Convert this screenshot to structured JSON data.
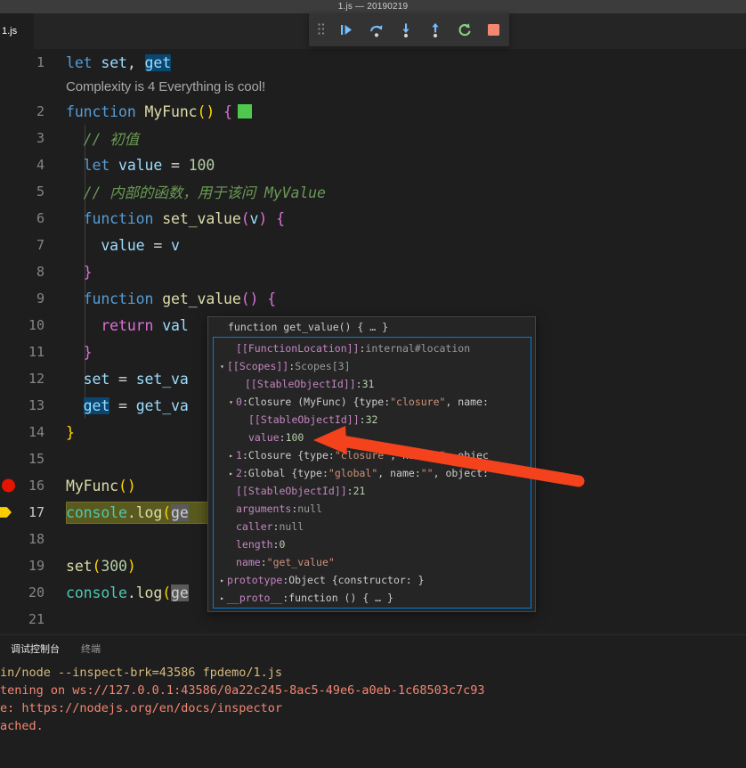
{
  "window": {
    "title": "1.js — 20190219"
  },
  "tabs": {
    "active_label": "1.js"
  },
  "debug_toolbar": {
    "grip": "drag-handle",
    "buttons": [
      {
        "name": "continue-button",
        "label": "Continue",
        "icon": "continue-icon"
      },
      {
        "name": "step-over-button",
        "label": "Step Over",
        "icon": "step-over-icon"
      },
      {
        "name": "step-into-button",
        "label": "Step Into",
        "icon": "step-into-icon"
      },
      {
        "name": "step-out-button",
        "label": "Step Out",
        "icon": "step-out-icon"
      },
      {
        "name": "restart-button",
        "label": "Restart",
        "icon": "restart-icon"
      },
      {
        "name": "stop-button",
        "label": "Stop",
        "icon": "stop-icon"
      }
    ]
  },
  "editor": {
    "inline_hint": "Complexity is 4 Everything is cool!",
    "lines": [
      {
        "num": "1",
        "tokens": [
          {
            "t": "let",
            "c": "t-kw"
          },
          {
            "t": " ",
            "c": "t-plain"
          },
          {
            "t": "set",
            "c": "t-var"
          },
          {
            "t": ", ",
            "c": "t-plain"
          },
          {
            "t": "get",
            "c": "sel"
          }
        ]
      },
      {
        "num": "2",
        "green_box": true,
        "tokens": [
          {
            "t": "function",
            "c": "t-kw"
          },
          {
            "t": " ",
            "c": "t-plain"
          },
          {
            "t": "MyFunc",
            "c": "t-fn"
          },
          {
            "t": "()",
            "c": "t-paren"
          },
          {
            "t": " ",
            "c": "t-plain"
          },
          {
            "t": "{",
            "c": "t-brace"
          }
        ]
      },
      {
        "num": "3",
        "indent": true,
        "tokens": [
          {
            "t": "  // 初值",
            "c": "t-com"
          }
        ]
      },
      {
        "num": "4",
        "indent": true,
        "tokens": [
          {
            "t": "  ",
            "c": "t-plain"
          },
          {
            "t": "let",
            "c": "t-kw"
          },
          {
            "t": " ",
            "c": "t-plain"
          },
          {
            "t": "value",
            "c": "t-var"
          },
          {
            "t": " = ",
            "c": "t-op"
          },
          {
            "t": "100",
            "c": "t-num"
          }
        ]
      },
      {
        "num": "5",
        "indent": true,
        "tokens": [
          {
            "t": "  // 内部的函数，用于该问 MyValue",
            "c": "t-com"
          }
        ]
      },
      {
        "num": "6",
        "indent": true,
        "tokens": [
          {
            "t": "  ",
            "c": "t-plain"
          },
          {
            "t": "function",
            "c": "t-kw"
          },
          {
            "t": " ",
            "c": "t-plain"
          },
          {
            "t": "set_value",
            "c": "t-fn"
          },
          {
            "t": "(",
            "c": "t-brace"
          },
          {
            "t": "v",
            "c": "t-var"
          },
          {
            "t": ")",
            "c": "t-brace"
          },
          {
            "t": " ",
            "c": "t-plain"
          },
          {
            "t": "{",
            "c": "t-brace"
          }
        ]
      },
      {
        "num": "7",
        "indent": true,
        "tokens": [
          {
            "t": "    ",
            "c": "t-plain"
          },
          {
            "t": "value",
            "c": "t-var"
          },
          {
            "t": " = ",
            "c": "t-op"
          },
          {
            "t": "v",
            "c": "t-var"
          }
        ]
      },
      {
        "num": "8",
        "indent": true,
        "tokens": [
          {
            "t": "  ",
            "c": "t-plain"
          },
          {
            "t": "}",
            "c": "t-brace"
          }
        ]
      },
      {
        "num": "9",
        "indent": true,
        "tokens": [
          {
            "t": "  ",
            "c": "t-plain"
          },
          {
            "t": "function",
            "c": "t-kw"
          },
          {
            "t": " ",
            "c": "t-plain"
          },
          {
            "t": "get_value",
            "c": "t-fn"
          },
          {
            "t": "()",
            "c": "t-brace"
          },
          {
            "t": " ",
            "c": "t-plain"
          },
          {
            "t": "{",
            "c": "t-brace"
          }
        ]
      },
      {
        "num": "10",
        "indent": true,
        "tokens": [
          {
            "t": "    ",
            "c": "t-plain"
          },
          {
            "t": "return",
            "c": "t-brace"
          },
          {
            "t": " ",
            "c": "t-plain"
          },
          {
            "t": "val",
            "c": "t-var"
          }
        ]
      },
      {
        "num": "11",
        "indent": true,
        "tokens": [
          {
            "t": "  ",
            "c": "t-plain"
          },
          {
            "t": "}",
            "c": "t-brace"
          }
        ]
      },
      {
        "num": "12",
        "indent": true,
        "tokens": [
          {
            "t": "  ",
            "c": "t-plain"
          },
          {
            "t": "set",
            "c": "t-var"
          },
          {
            "t": " = ",
            "c": "t-op"
          },
          {
            "t": "set_va",
            "c": "t-var"
          }
        ]
      },
      {
        "num": "13",
        "indent": true,
        "tokens": [
          {
            "t": "  ",
            "c": "t-plain"
          },
          {
            "t": "get",
            "c": "sel"
          },
          {
            "t": " = ",
            "c": "t-op"
          },
          {
            "t": "get_va",
            "c": "t-var"
          }
        ]
      },
      {
        "num": "14",
        "tokens": [
          {
            "t": "}",
            "c": "t-paren"
          }
        ]
      },
      {
        "num": "15",
        "tokens": []
      },
      {
        "num": "16",
        "breakpoint": "dot",
        "tokens": [
          {
            "t": "MyFunc",
            "c": "t-fn"
          },
          {
            "t": "()",
            "c": "t-paren"
          }
        ]
      },
      {
        "num": "17",
        "breakpoint": "arrow",
        "current": true,
        "exec_width": 170,
        "tokens": [
          {
            "t": "console",
            "c": "t-prop"
          },
          {
            "t": ".",
            "c": "t-plain"
          },
          {
            "t": "log",
            "c": "t-fn"
          },
          {
            "t": "(",
            "c": "t-paren"
          },
          {
            "t": "ge",
            "c": "inline-ghost"
          }
        ]
      },
      {
        "num": "18",
        "tokens": []
      },
      {
        "num": "19",
        "tokens": [
          {
            "t": "set",
            "c": "t-fn"
          },
          {
            "t": "(",
            "c": "t-paren"
          },
          {
            "t": "300",
            "c": "t-num"
          },
          {
            "t": ")",
            "c": "t-paren"
          }
        ]
      },
      {
        "num": "20",
        "tokens": [
          {
            "t": "console",
            "c": "t-prop"
          },
          {
            "t": ".",
            "c": "t-plain"
          },
          {
            "t": "log",
            "c": "t-fn"
          },
          {
            "t": "(",
            "c": "t-paren"
          },
          {
            "t": "ge",
            "c": "inline-ghost"
          }
        ]
      },
      {
        "num": "21",
        "tokens": []
      }
    ]
  },
  "debug_popup": {
    "header": "function get_value() { … }",
    "rows": [
      {
        "twist": "none",
        "indent": 10,
        "parts": [
          {
            "t": "[[FunctionLocation]]",
            "c": "p-key"
          },
          {
            "t": ": ",
            "c": "p-name"
          },
          {
            "t": "internal#location",
            "c": "p-dim"
          }
        ]
      },
      {
        "twist": "open",
        "indent": 0,
        "parts": [
          {
            "t": "[[Scopes]]",
            "c": "p-key"
          },
          {
            "t": ": ",
            "c": "p-name"
          },
          {
            "t": "Scopes[3]",
            "c": "p-dim"
          }
        ]
      },
      {
        "twist": "none",
        "indent": 20,
        "parts": [
          {
            "t": "[[StableObjectId]]",
            "c": "p-key"
          },
          {
            "t": ": ",
            "c": "p-name"
          },
          {
            "t": "31",
            "c": "p-num"
          }
        ]
      },
      {
        "twist": "open",
        "indent": 10,
        "parts": [
          {
            "t": "0",
            "c": "p-int"
          },
          {
            "t": ": ",
            "c": "p-name"
          },
          {
            "t": "Closure (MyFunc) {type: ",
            "c": "p-name"
          },
          {
            "t": "\"closure\"",
            "c": "p-str"
          },
          {
            "t": ", name:",
            "c": "p-name"
          }
        ]
      },
      {
        "twist": "none",
        "indent": 24,
        "parts": [
          {
            "t": "[[StableObjectId]]",
            "c": "p-key"
          },
          {
            "t": ": ",
            "c": "p-name"
          },
          {
            "t": "32",
            "c": "p-num"
          }
        ]
      },
      {
        "twist": "none",
        "indent": 24,
        "parts": [
          {
            "t": "value",
            "c": "p-key"
          },
          {
            "t": ": ",
            "c": "p-name"
          },
          {
            "t": "100",
            "c": "p-num"
          }
        ]
      },
      {
        "twist": "closed",
        "indent": 10,
        "parts": [
          {
            "t": "1",
            "c": "p-int"
          },
          {
            "t": ": ",
            "c": "p-name"
          },
          {
            "t": "Closure {type: ",
            "c": "p-name"
          },
          {
            "t": "\"closure\"",
            "c": "p-str"
          },
          {
            "t": ", name: ",
            "c": "p-name"
          },
          {
            "t": "\"\"",
            "c": "p-str"
          },
          {
            "t": ", objec",
            "c": "p-name"
          }
        ]
      },
      {
        "twist": "closed",
        "indent": 10,
        "parts": [
          {
            "t": "2",
            "c": "p-int"
          },
          {
            "t": ": ",
            "c": "p-name"
          },
          {
            "t": "Global {type: ",
            "c": "p-name"
          },
          {
            "t": "\"global\"",
            "c": "p-str"
          },
          {
            "t": ", name: ",
            "c": "p-name"
          },
          {
            "t": "\"\"",
            "c": "p-str"
          },
          {
            "t": ", object:",
            "c": "p-name"
          }
        ]
      },
      {
        "twist": "none",
        "indent": 10,
        "parts": [
          {
            "t": "[[StableObjectId]]",
            "c": "p-key"
          },
          {
            "t": ": ",
            "c": "p-name"
          },
          {
            "t": "21",
            "c": "p-num"
          }
        ]
      },
      {
        "twist": "none",
        "indent": 10,
        "parts": [
          {
            "t": "arguments",
            "c": "p-key"
          },
          {
            "t": ": ",
            "c": "p-name"
          },
          {
            "t": "null",
            "c": "p-null"
          }
        ]
      },
      {
        "twist": "none",
        "indent": 10,
        "parts": [
          {
            "t": "caller",
            "c": "p-key"
          },
          {
            "t": ": ",
            "c": "p-name"
          },
          {
            "t": "null",
            "c": "p-null"
          }
        ]
      },
      {
        "twist": "none",
        "indent": 10,
        "parts": [
          {
            "t": "length",
            "c": "p-key"
          },
          {
            "t": ": ",
            "c": "p-name"
          },
          {
            "t": "0",
            "c": "p-num"
          }
        ]
      },
      {
        "twist": "none",
        "indent": 10,
        "parts": [
          {
            "t": "name",
            "c": "p-key"
          },
          {
            "t": ": ",
            "c": "p-name"
          },
          {
            "t": "\"get_value\"",
            "c": "p-str"
          }
        ]
      },
      {
        "twist": "closed",
        "indent": 0,
        "parts": [
          {
            "t": "prototype",
            "c": "p-key"
          },
          {
            "t": ": ",
            "c": "p-name"
          },
          {
            "t": "Object {constructor: }",
            "c": "p-obj"
          }
        ]
      },
      {
        "twist": "closed",
        "indent": 0,
        "parts": [
          {
            "t": "__proto__",
            "c": "p-key"
          },
          {
            "t": ": ",
            "c": "p-name"
          },
          {
            "t": "function () { … }",
            "c": "p-obj"
          }
        ]
      }
    ]
  },
  "panel": {
    "tabs": [
      {
        "label": "调试控制台",
        "active": true
      },
      {
        "label": "终端",
        "active": false
      }
    ],
    "console_lines": [
      {
        "text": "in/node --inspect-brk=43586 fpdemo/1.js",
        "color": "c-yellow"
      },
      {
        "text": "tening on ws://127.0.0.1:43586/0a22c245-8ac5-49e6-a0eb-1c68503c7c93",
        "color": "c-red"
      },
      {
        "text": "e: https://nodejs.org/en/docs/inspector",
        "color": "c-red"
      },
      {
        "text": "ached.",
        "color": "c-red"
      }
    ]
  },
  "annotation": {
    "type": "red-arrow",
    "points_to": "value: 100",
    "color": "#f4431c"
  }
}
